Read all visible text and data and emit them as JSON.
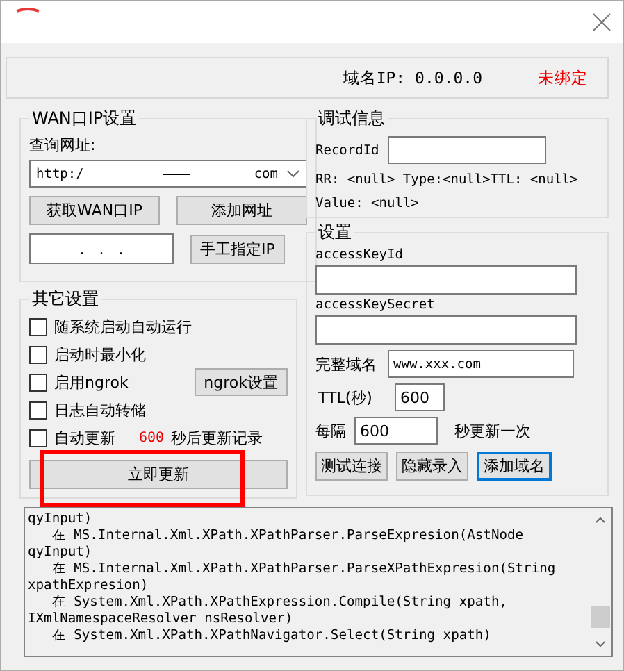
{
  "status": {
    "domain_ip": "域名IP: 0.0.0.0",
    "binding": "未绑定"
  },
  "wan": {
    "title": "WAN口IP设置",
    "query_label": "查询网址:",
    "url_start": "http:/",
    "url_end": "com",
    "buttons": [
      "获取WAN口IP",
      "添加网址"
    ],
    "ip_value": ".   .   .",
    "manual_button": "手工指定IP"
  },
  "other": {
    "title": "其它设置",
    "options": [
      {
        "label": "随系统启动自动运行",
        "checked": false
      },
      {
        "label": "启动时最小化",
        "checked": false
      },
      {
        "label": "启用ngrok",
        "checked": false
      },
      {
        "label": "日志自动转储",
        "checked": false
      }
    ],
    "ngrok_button": "ngrok设置",
    "auto_update": {
      "label": "自动更新",
      "checked": false,
      "interval": "600",
      "suffix": "秒后更新记录"
    },
    "update_button": "立即更新"
  },
  "debug": {
    "title": "调试信息",
    "record_label": "RecordId",
    "rr_line": "RR: <null> Type:<null>TTL: <null>",
    "value_line": "Value: <null>"
  },
  "settings": {
    "title": "设置",
    "key_id_label": "accessKeyId",
    "key_secret_label": "accessKeySecret",
    "domain_label": "完整域名",
    "domain_value": "www.xxx.com",
    "ttl_label": "TTL(秒)",
    "ttl_value": "600",
    "every_label": "每隔",
    "every_value": "600",
    "every_suffix": "秒更新一次",
    "buttons": [
      {
        "label": "测试连接",
        "selected": false
      },
      {
        "label": "隐藏录入",
        "selected": false
      },
      {
        "label": "添加域名",
        "selected": true
      }
    ]
  },
  "log": {
    "lines": [
      "qyInput)",
      "   在 MS.Internal.Xml.XPath.XPathParser.ParseExpresion(AstNode",
      "qyInput)",
      "   在 MS.Internal.Xml.XPath.XPathParser.ParseXPathExpresion(String",
      "xpathExpresion)",
      "   在 System.Xml.XPath.XPathExpression.Compile(String xpath,",
      "IXmlNamespaceResolver nsResolver)",
      "   在 System.Xml.XPath.XPathNavigator.Select(String xpath)"
    ]
  },
  "annotation": {
    "highlight": true
  }
}
